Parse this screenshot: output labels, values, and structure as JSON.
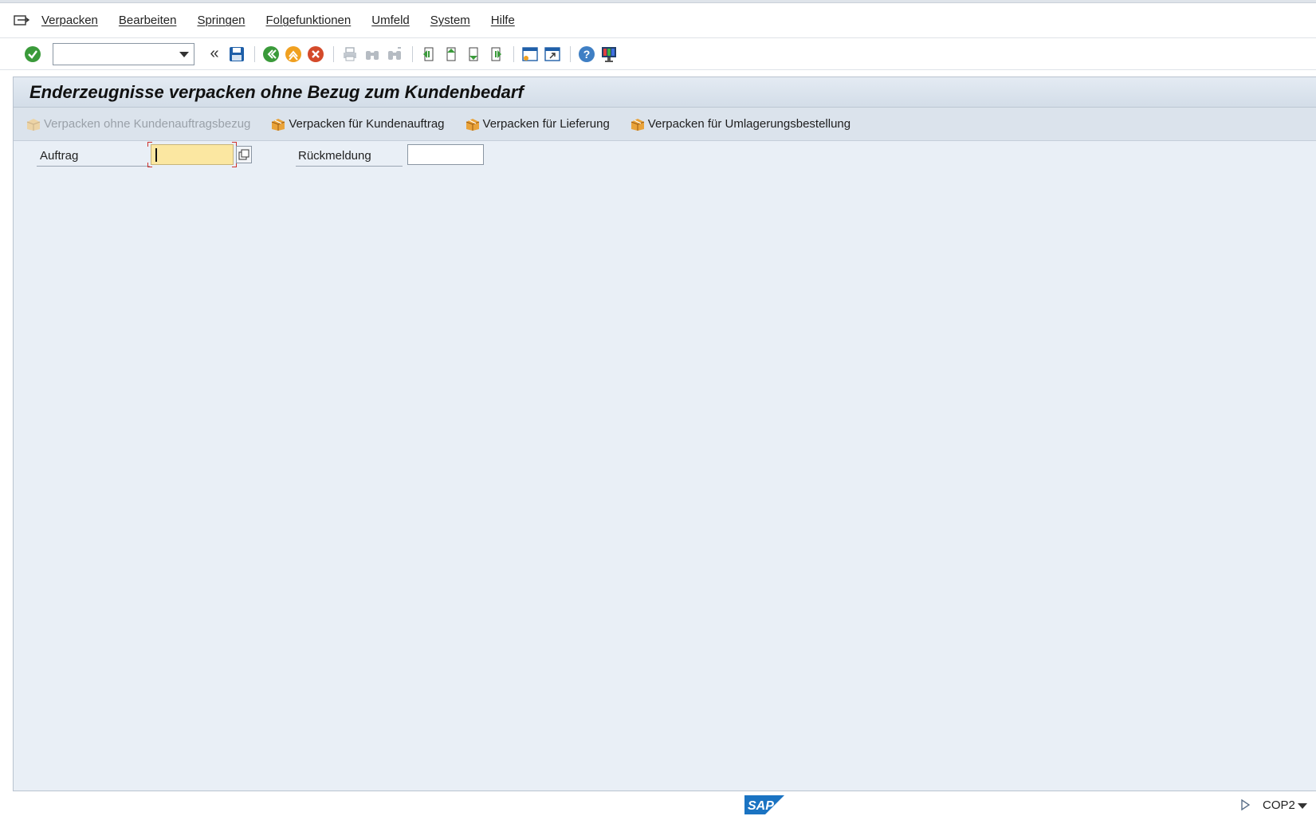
{
  "menu": {
    "items": [
      {
        "label": "Verpacken"
      },
      {
        "label": "Bearbeiten"
      },
      {
        "label": "Springen"
      },
      {
        "label": "Folgefunktionen"
      },
      {
        "label": "Umfeld"
      },
      {
        "label": "System"
      },
      {
        "label": "Hilfe"
      }
    ]
  },
  "toolbar": {
    "command_field": {
      "value": "",
      "placeholder": ""
    },
    "icons": [
      "enter-icon",
      "history-back-icon",
      "save-icon",
      "back-icon",
      "exit-icon",
      "cancel-icon",
      "print-icon",
      "find-icon",
      "find-next-icon",
      "first-page-icon",
      "previous-page-icon",
      "next-page-icon",
      "last-page-icon",
      "create-session-icon",
      "shortcut-icon",
      "help-icon",
      "customize-layout-icon"
    ],
    "history_label": "«"
  },
  "screen": {
    "title": "Enderzeugnisse verpacken ohne Bezug zum Kundenbedarf",
    "app_buttons": [
      {
        "label": "Verpacken ohne Kundenauftragsbezug",
        "enabled": false
      },
      {
        "label": "Verpacken für Kundenauftrag",
        "enabled": true
      },
      {
        "label": "Verpacken für Lieferung",
        "enabled": true
      },
      {
        "label": "Verpacken für Umlagerungsbestellung",
        "enabled": true
      }
    ],
    "fields": {
      "auftrag": {
        "label": "Auftrag",
        "value": ""
      },
      "rueckmeldung": {
        "label": "Rückmeldung",
        "value": ""
      }
    }
  },
  "status": {
    "logo": "SAP",
    "system": "COP2"
  },
  "colors": {
    "main_bg": "#e9eff6",
    "focus_field": "#fbe7a1",
    "sap_blue": "#1a73c2"
  }
}
